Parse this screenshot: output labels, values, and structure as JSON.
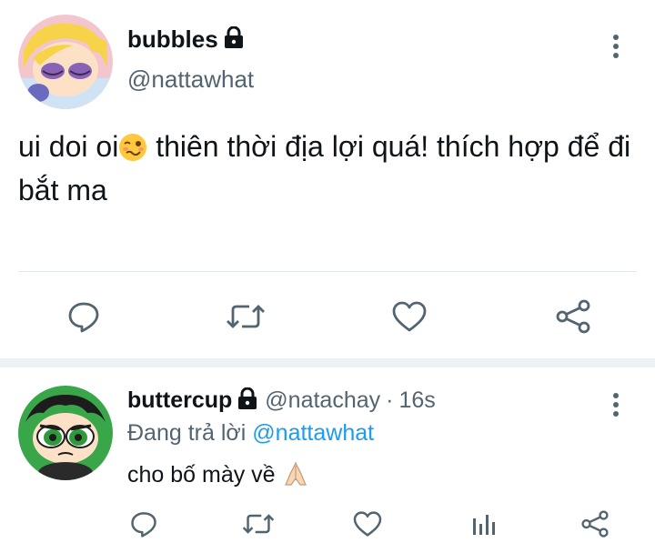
{
  "main_tweet": {
    "display_name": "bubbles",
    "handle": "@nattawhat",
    "text_part1": "ui doi oi",
    "text_part2": " thiên thời địa lợi quá! thích hợp để đi bắt ma",
    "emoji": "woozy-face",
    "actions": [
      "reply-icon",
      "retweet-icon",
      "like-icon",
      "share-icon"
    ]
  },
  "reply_tweet": {
    "display_name": "buttercup",
    "handle": "@natachay",
    "separator": "·",
    "time": "16s",
    "replying_prefix": "Đang trả lời",
    "replying_to": "@nattawhat",
    "text": "cho bố mày về",
    "emoji": "folded-hands",
    "actions": [
      "reply-icon",
      "retweet-icon",
      "like-icon",
      "stats-icon",
      "share-icon"
    ]
  },
  "colors": {
    "text": "#0f1419",
    "secondary": "#536471",
    "accent": "#1d9bf0",
    "divider": "#e1e6ea"
  }
}
